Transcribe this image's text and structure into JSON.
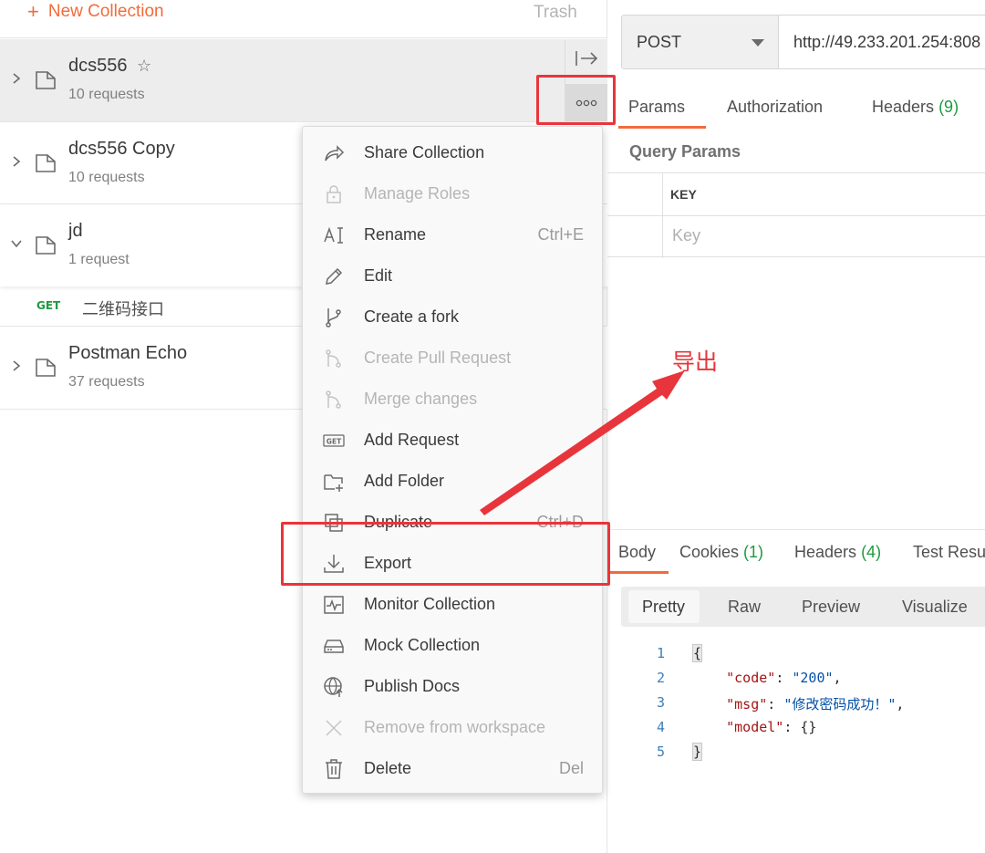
{
  "sidebar": {
    "new_collection_label": "New Collection",
    "trash_label": "Trash",
    "collections": [
      {
        "name": "dcs556",
        "count": "10 requests",
        "starred": true,
        "expanded": false,
        "active": true
      },
      {
        "name": "dcs556 Copy",
        "count": "10 requests",
        "expanded": false
      },
      {
        "name": "jd",
        "count": "1 request",
        "expanded": true
      },
      {
        "name": "Postman Echo",
        "count": "37 requests",
        "expanded": false
      }
    ],
    "request": {
      "method": "GET",
      "name": "二维码接口"
    }
  },
  "context_menu": {
    "items": [
      {
        "label": "Share Collection",
        "icon": "share-icon",
        "shortcut": "",
        "disabled": false
      },
      {
        "label": "Manage Roles",
        "icon": "lock-icon",
        "shortcut": "",
        "disabled": true
      },
      {
        "label": "Rename",
        "icon": "rename-icon",
        "shortcut": "Ctrl+E",
        "disabled": false
      },
      {
        "label": "Edit",
        "icon": "pencil-icon",
        "shortcut": "",
        "disabled": false
      },
      {
        "label": "Create a fork",
        "icon": "fork-icon",
        "shortcut": "",
        "disabled": false
      },
      {
        "label": "Create Pull Request",
        "icon": "pull-request-icon",
        "shortcut": "",
        "disabled": true
      },
      {
        "label": "Merge changes",
        "icon": "merge-icon",
        "shortcut": "",
        "disabled": true
      },
      {
        "label": "Add Request",
        "icon": "get-request-icon",
        "shortcut": "",
        "disabled": false
      },
      {
        "label": "Add Folder",
        "icon": "add-folder-icon",
        "shortcut": "",
        "disabled": false
      },
      {
        "label": "Duplicate",
        "icon": "duplicate-icon",
        "shortcut": "Ctrl+D",
        "disabled": false
      },
      {
        "label": "Export",
        "icon": "download-icon",
        "shortcut": "",
        "disabled": false
      },
      {
        "label": "Monitor Collection",
        "icon": "monitor-icon",
        "shortcut": "",
        "disabled": false
      },
      {
        "label": "Mock Collection",
        "icon": "mock-server-icon",
        "shortcut": "",
        "disabled": false
      },
      {
        "label": "Publish Docs",
        "icon": "globe-icon",
        "shortcut": "",
        "disabled": false
      },
      {
        "label": "Remove from workspace",
        "icon": "close-icon",
        "shortcut": "",
        "disabled": true
      },
      {
        "label": "Delete",
        "icon": "trash-icon",
        "shortcut": "Del",
        "disabled": false
      }
    ]
  },
  "request_pane": {
    "method": "POST",
    "url": "http://49.233.201.254:808",
    "tabs": [
      {
        "label": "Params",
        "count": "",
        "active": true
      },
      {
        "label": "Authorization",
        "count": ""
      },
      {
        "label": "Headers",
        "count": "(9)"
      }
    ],
    "query_params_title": "Query Params",
    "key_header": "KEY",
    "key_placeholder": "Key"
  },
  "response_pane": {
    "tabs": [
      {
        "label": "Body",
        "count": "",
        "active": true
      },
      {
        "label": "Cookies",
        "count": "(1)"
      },
      {
        "label": "Headers",
        "count": "(4)"
      },
      {
        "label": "Test Resu",
        "count": ""
      }
    ],
    "view_modes": [
      "Pretty",
      "Raw",
      "Preview",
      "Visualize"
    ],
    "active_view": "Pretty",
    "code_lines": [
      {
        "n": "1",
        "text": "{"
      },
      {
        "n": "2",
        "key": "\"code\"",
        "value": "\"200\"",
        "trail": ","
      },
      {
        "n": "3",
        "key": "\"msg\"",
        "value": "\"修改密码成功！\"",
        "trail": ","
      },
      {
        "n": "4",
        "key": "\"model\"",
        "value": "{}",
        "trail": ""
      },
      {
        "n": "5",
        "text": "}"
      }
    ]
  },
  "annotation": {
    "label": "导出",
    "color": "#e8353b"
  },
  "colors": {
    "accent": "#f26b3a",
    "count_green": "#1e9a3f",
    "annotation_red": "#e8353b"
  }
}
